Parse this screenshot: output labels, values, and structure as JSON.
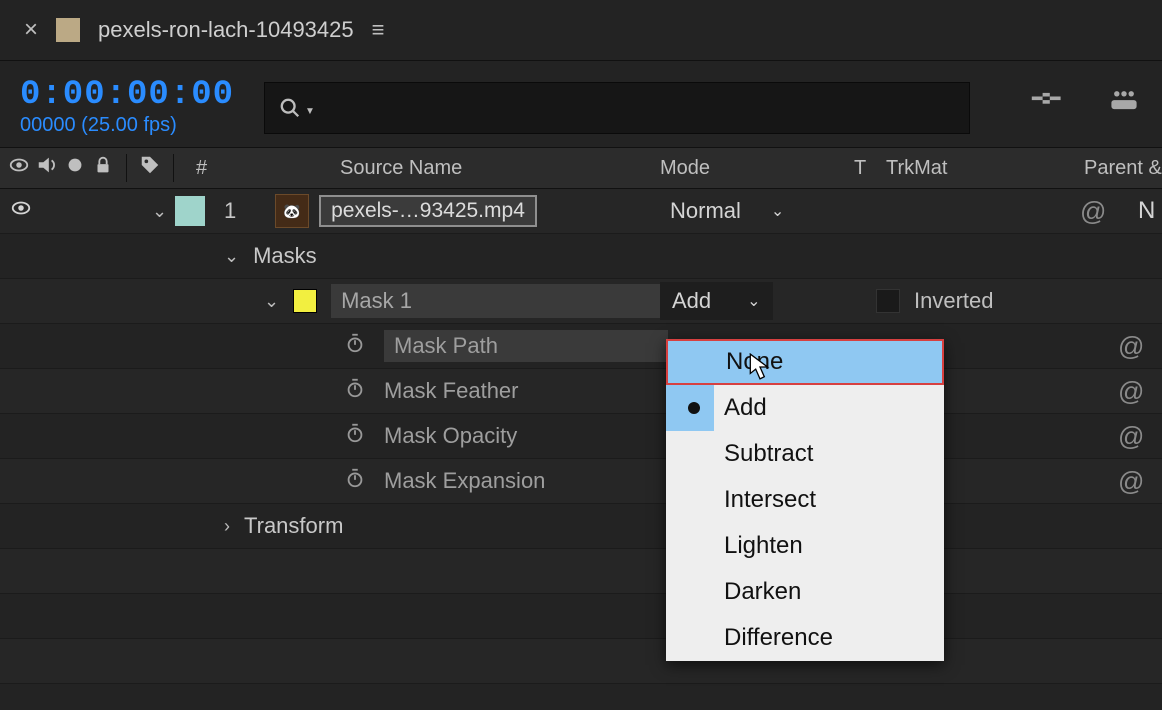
{
  "tab": {
    "title": "pexels-ron-lach-10493425"
  },
  "time": {
    "timecode": "0:00:00:00",
    "frames": "00000 (25.00 fps)"
  },
  "columns": {
    "hash": "#",
    "source": "Source Name",
    "mode": "Mode",
    "t": "T",
    "trkmat": "TrkMat",
    "parent": "Parent &"
  },
  "layer": {
    "number": "1",
    "name": "pexels-…93425.mp4",
    "mode": "Normal",
    "parent_initial": "N"
  },
  "groups": {
    "masks": "Masks",
    "transform": "Transform"
  },
  "mask": {
    "name": "Mask 1",
    "mode": "Add",
    "inverted_label": "Inverted",
    "props": [
      "Mask Path",
      "Mask Feather",
      "Mask Opacity",
      "Mask Expansion"
    ]
  },
  "blend_modes": {
    "items": [
      "None",
      "Add",
      "Subtract",
      "Intersect",
      "Lighten",
      "Darken",
      "Difference"
    ],
    "hovered": "None",
    "current": "Add"
  }
}
